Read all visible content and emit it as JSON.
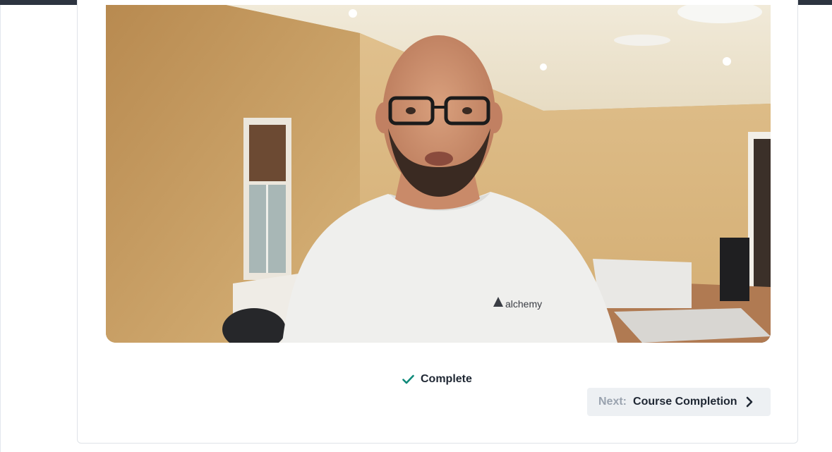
{
  "lesson": {
    "video": {
      "shirt_logo_text": "alchemy"
    },
    "complete": {
      "label": "Complete",
      "icon": "checkmark-icon",
      "accent": "#0f8a7a"
    },
    "next": {
      "prefix": "Next:",
      "title": "Course Completion",
      "icon": "chevron-right-icon"
    }
  }
}
